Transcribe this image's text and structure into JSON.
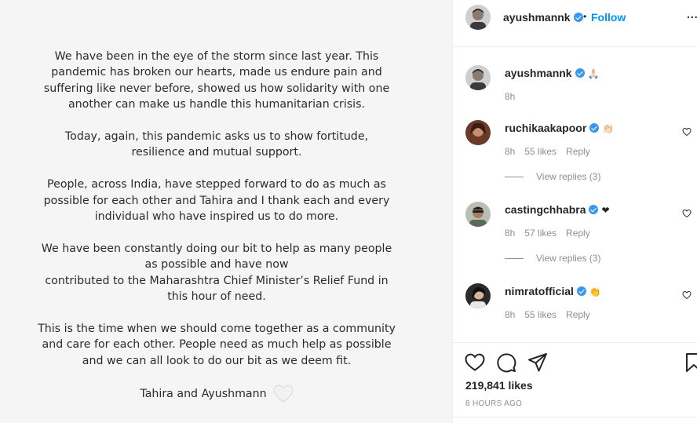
{
  "post": {
    "paragraphs": [
      "We have been in the eye of the storm since last year. This\npandemic has broken our hearts, made us endure pain and\nsuffering like never before, showed us how solidarity with one\nanother can make us handle this humanitarian crisis.",
      "Today, again, this pandemic asks us to show fortitude,\nresilience and mutual support.",
      "People, across India, have stepped forward to do as much as\npossible for each other and Tahira and I thank each and every\nindividual who have inspired us to do more.",
      "We have been constantly doing our bit to help as many people\nas possible and have now\ncontributed to the Maharashtra Chief Minister’s Relief Fund in\nthis hour of need.",
      "This is the time when we should come together as a community\nand care for each other. People need as much help as possible\nand we can all look to do our bit as we deem fit."
    ],
    "signature": "Tahira and Ayushmann"
  },
  "header": {
    "username": "ayushmannk",
    "dot": "•",
    "follow_label": "Follow",
    "more_label": "..."
  },
  "comments": [
    {
      "username": "ayushmannk",
      "text": "🙏🏻",
      "time": "8h",
      "likes": "",
      "reply": "",
      "view_replies": ""
    },
    {
      "username": "ruchikaakapoor",
      "text": "👏🏻",
      "time": "8h",
      "likes": "55 likes",
      "reply": "Reply",
      "view_replies": "View replies (3)"
    },
    {
      "username": "castingchhabra",
      "text": "❤",
      "time": "8h",
      "likes": "57 likes",
      "reply": "Reply",
      "view_replies": "View replies (3)"
    },
    {
      "username": "nimratofficial",
      "text": "👏",
      "time": "8h",
      "likes": "55 likes",
      "reply": "Reply",
      "view_replies": ""
    }
  ],
  "footer": {
    "likes": "219,841 likes",
    "time": "8 HOURS AGO"
  },
  "icons": {
    "like": "heart-outline-icon",
    "comment": "speech-bubble-icon",
    "share": "paper-plane-icon",
    "save": "bookmark-icon"
  },
  "colors": {
    "accent": "#0095f6",
    "verified": "#3897f0",
    "muted": "#8e8e8e"
  }
}
